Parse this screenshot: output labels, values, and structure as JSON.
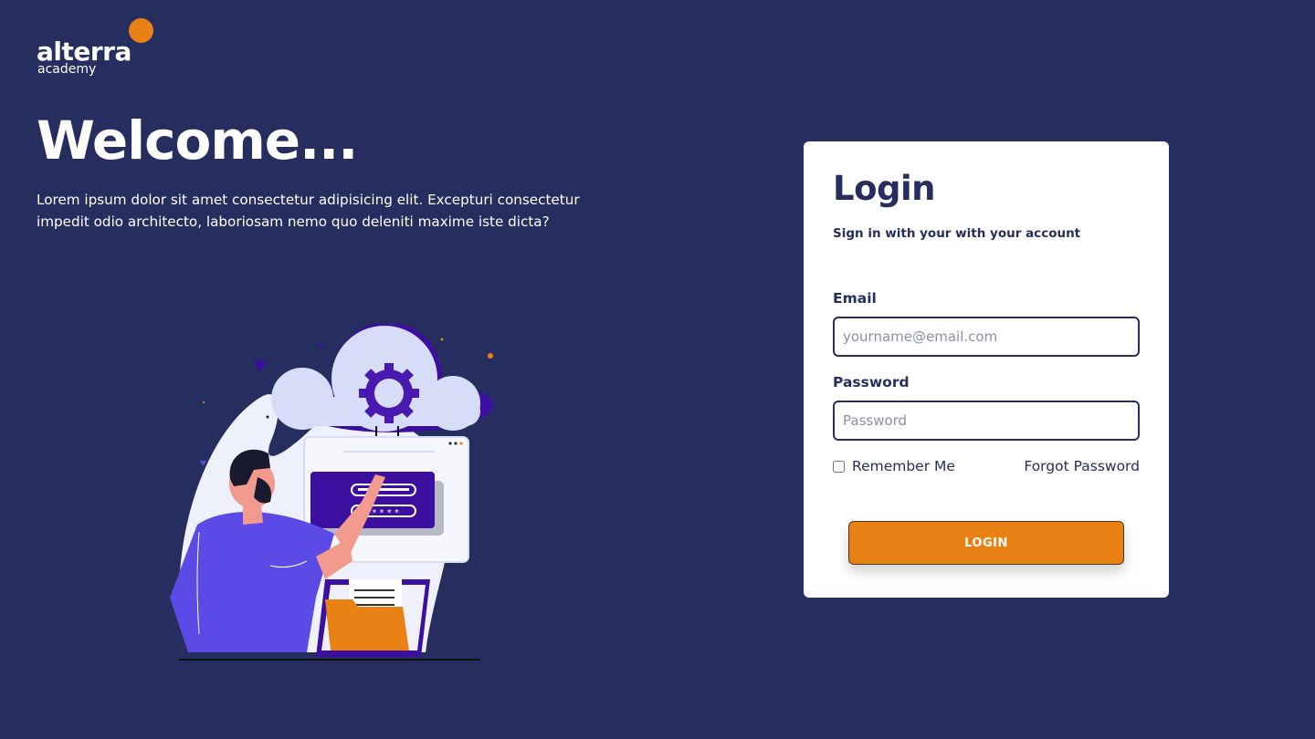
{
  "brand": {
    "name": "alterra",
    "tagline": "academy"
  },
  "hero": {
    "heading": "Welcome...",
    "description": "Lorem ipsum dolor sit amet consectetur adipisicing elit. Excepturi consectetur impedit odio architecto, laboriosam nemo quo deleniti maxime iste dicta?"
  },
  "login": {
    "title": "Login",
    "subtitle": "Sign in with your with your account",
    "email_label": "Email",
    "email_placeholder": "yourname@email.com",
    "password_label": "Password",
    "password_placeholder": "Password",
    "remember_label": "Remember Me",
    "forgot_label": "Forgot Password",
    "submit_label": "LOGIN"
  },
  "colors": {
    "background": "#252e5f",
    "accent": "#e98114",
    "card": "#ffffff",
    "illustration_purple": "#5b4ae6",
    "illustration_dark_purple": "#3d0fa0"
  }
}
